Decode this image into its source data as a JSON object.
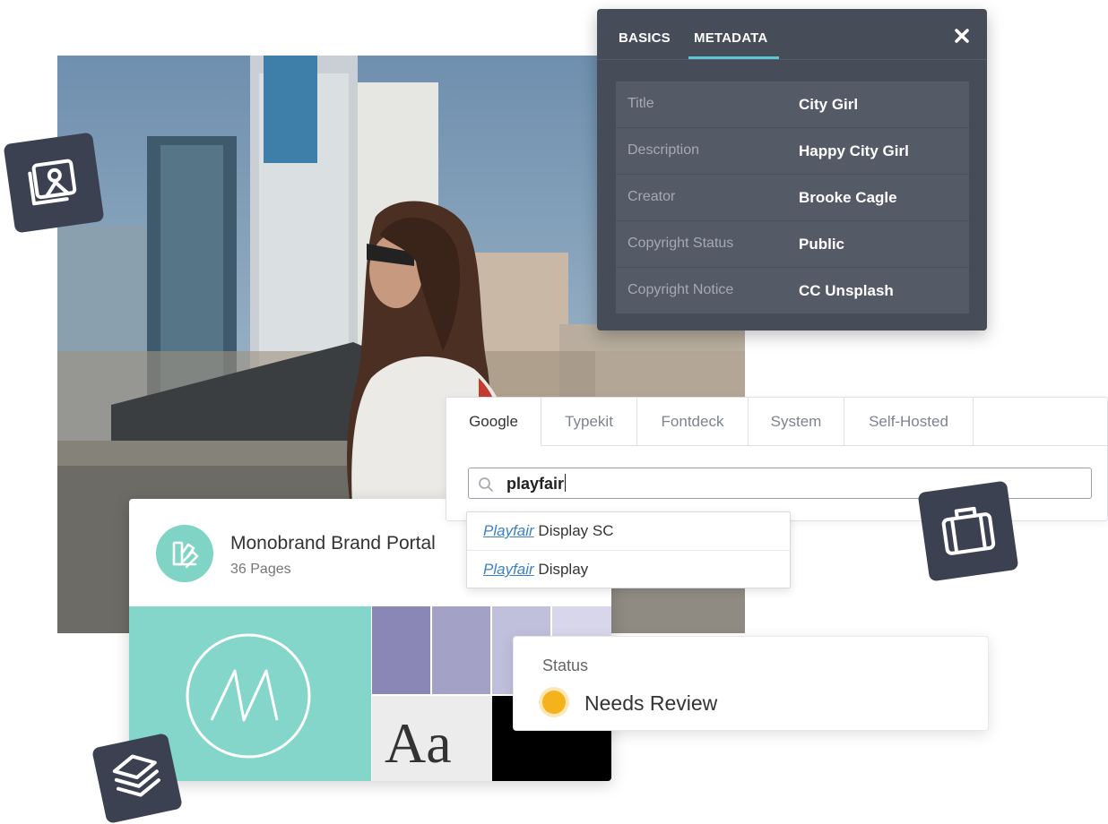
{
  "metadata_panel": {
    "tabs": [
      "BASICS",
      "METADATA"
    ],
    "active_tab": "METADATA",
    "close_icon": "close-icon",
    "rows": [
      {
        "key": "Title",
        "value": "City Girl"
      },
      {
        "key": "Description",
        "value": "Happy City Girl"
      },
      {
        "key": "Creator",
        "value": "Brooke Cagle"
      },
      {
        "key": "Copyright Status",
        "value": "Public"
      },
      {
        "key": "Copyright Notice",
        "value": "CC Unsplash"
      }
    ]
  },
  "font_picker": {
    "tabs": [
      "Google",
      "Typekit",
      "Fontdeck",
      "System",
      "Self-Hosted"
    ],
    "active_tab": "Google",
    "search_value": "playfair",
    "search_icon": "search-icon",
    "suggestions": [
      {
        "match": "Playfair",
        "rest": " Display SC"
      },
      {
        "match": "Playfair",
        "rest": " Display"
      }
    ]
  },
  "brand_card": {
    "title": "Monobrand Brand Portal",
    "subtitle": "36 Pages",
    "avatar_icon": "swatch-fan-icon",
    "typography_sample": "Aa",
    "colors": {
      "teal": "#84d6cb",
      "purple_1": "#8a86b6",
      "purple_2": "#a3a1c6",
      "purple_3": "#c1c0dc",
      "purple_4": "#d7d6ea",
      "black": "#000000"
    }
  },
  "status_card": {
    "label": "Status",
    "value": "Needs Review",
    "status_color": "#f5b21d"
  },
  "badges": [
    "images-icon",
    "suitcase-icon",
    "layers-icon"
  ]
}
